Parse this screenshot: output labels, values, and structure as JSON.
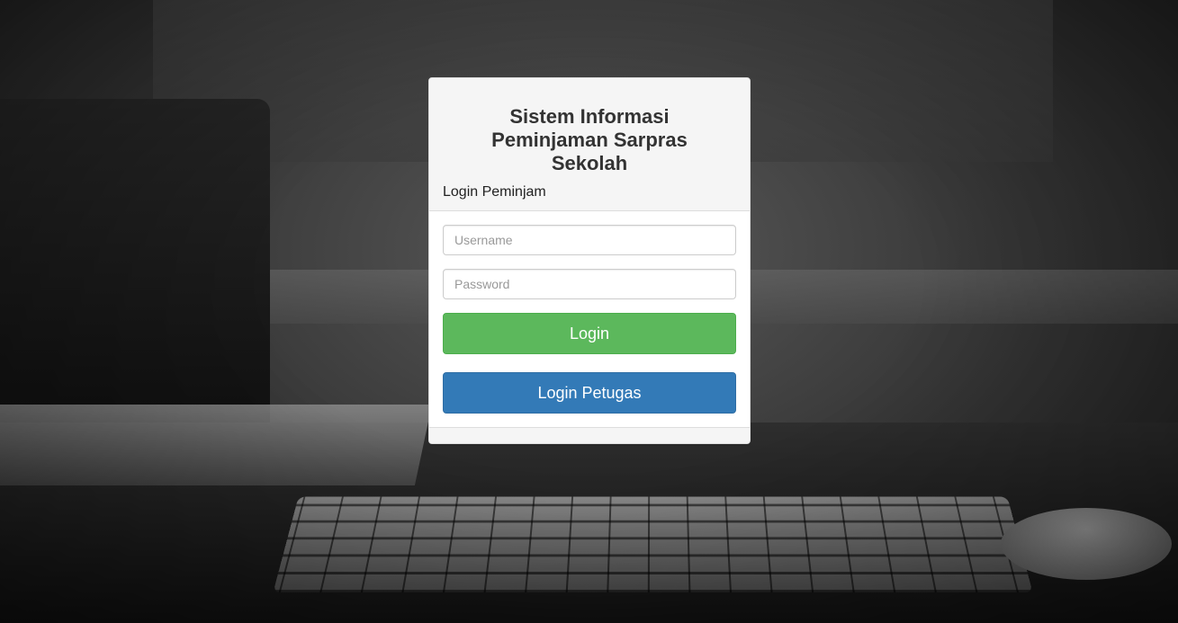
{
  "login_panel": {
    "title": "Sistem Informasi Peminjaman Sarpras Sekolah",
    "subtitle": "Login Peminjam",
    "username_placeholder": "Username",
    "username_value": "",
    "password_placeholder": "Password",
    "password_value": "",
    "login_button_label": "Login",
    "login_petugas_button_label": "Login Petugas"
  },
  "colors": {
    "login_button": "#5cb85c",
    "login_petugas_button": "#337ab7",
    "panel_heading_bg": "#f5f5f5"
  },
  "background": {
    "description_icon": "desk-photo-background"
  }
}
